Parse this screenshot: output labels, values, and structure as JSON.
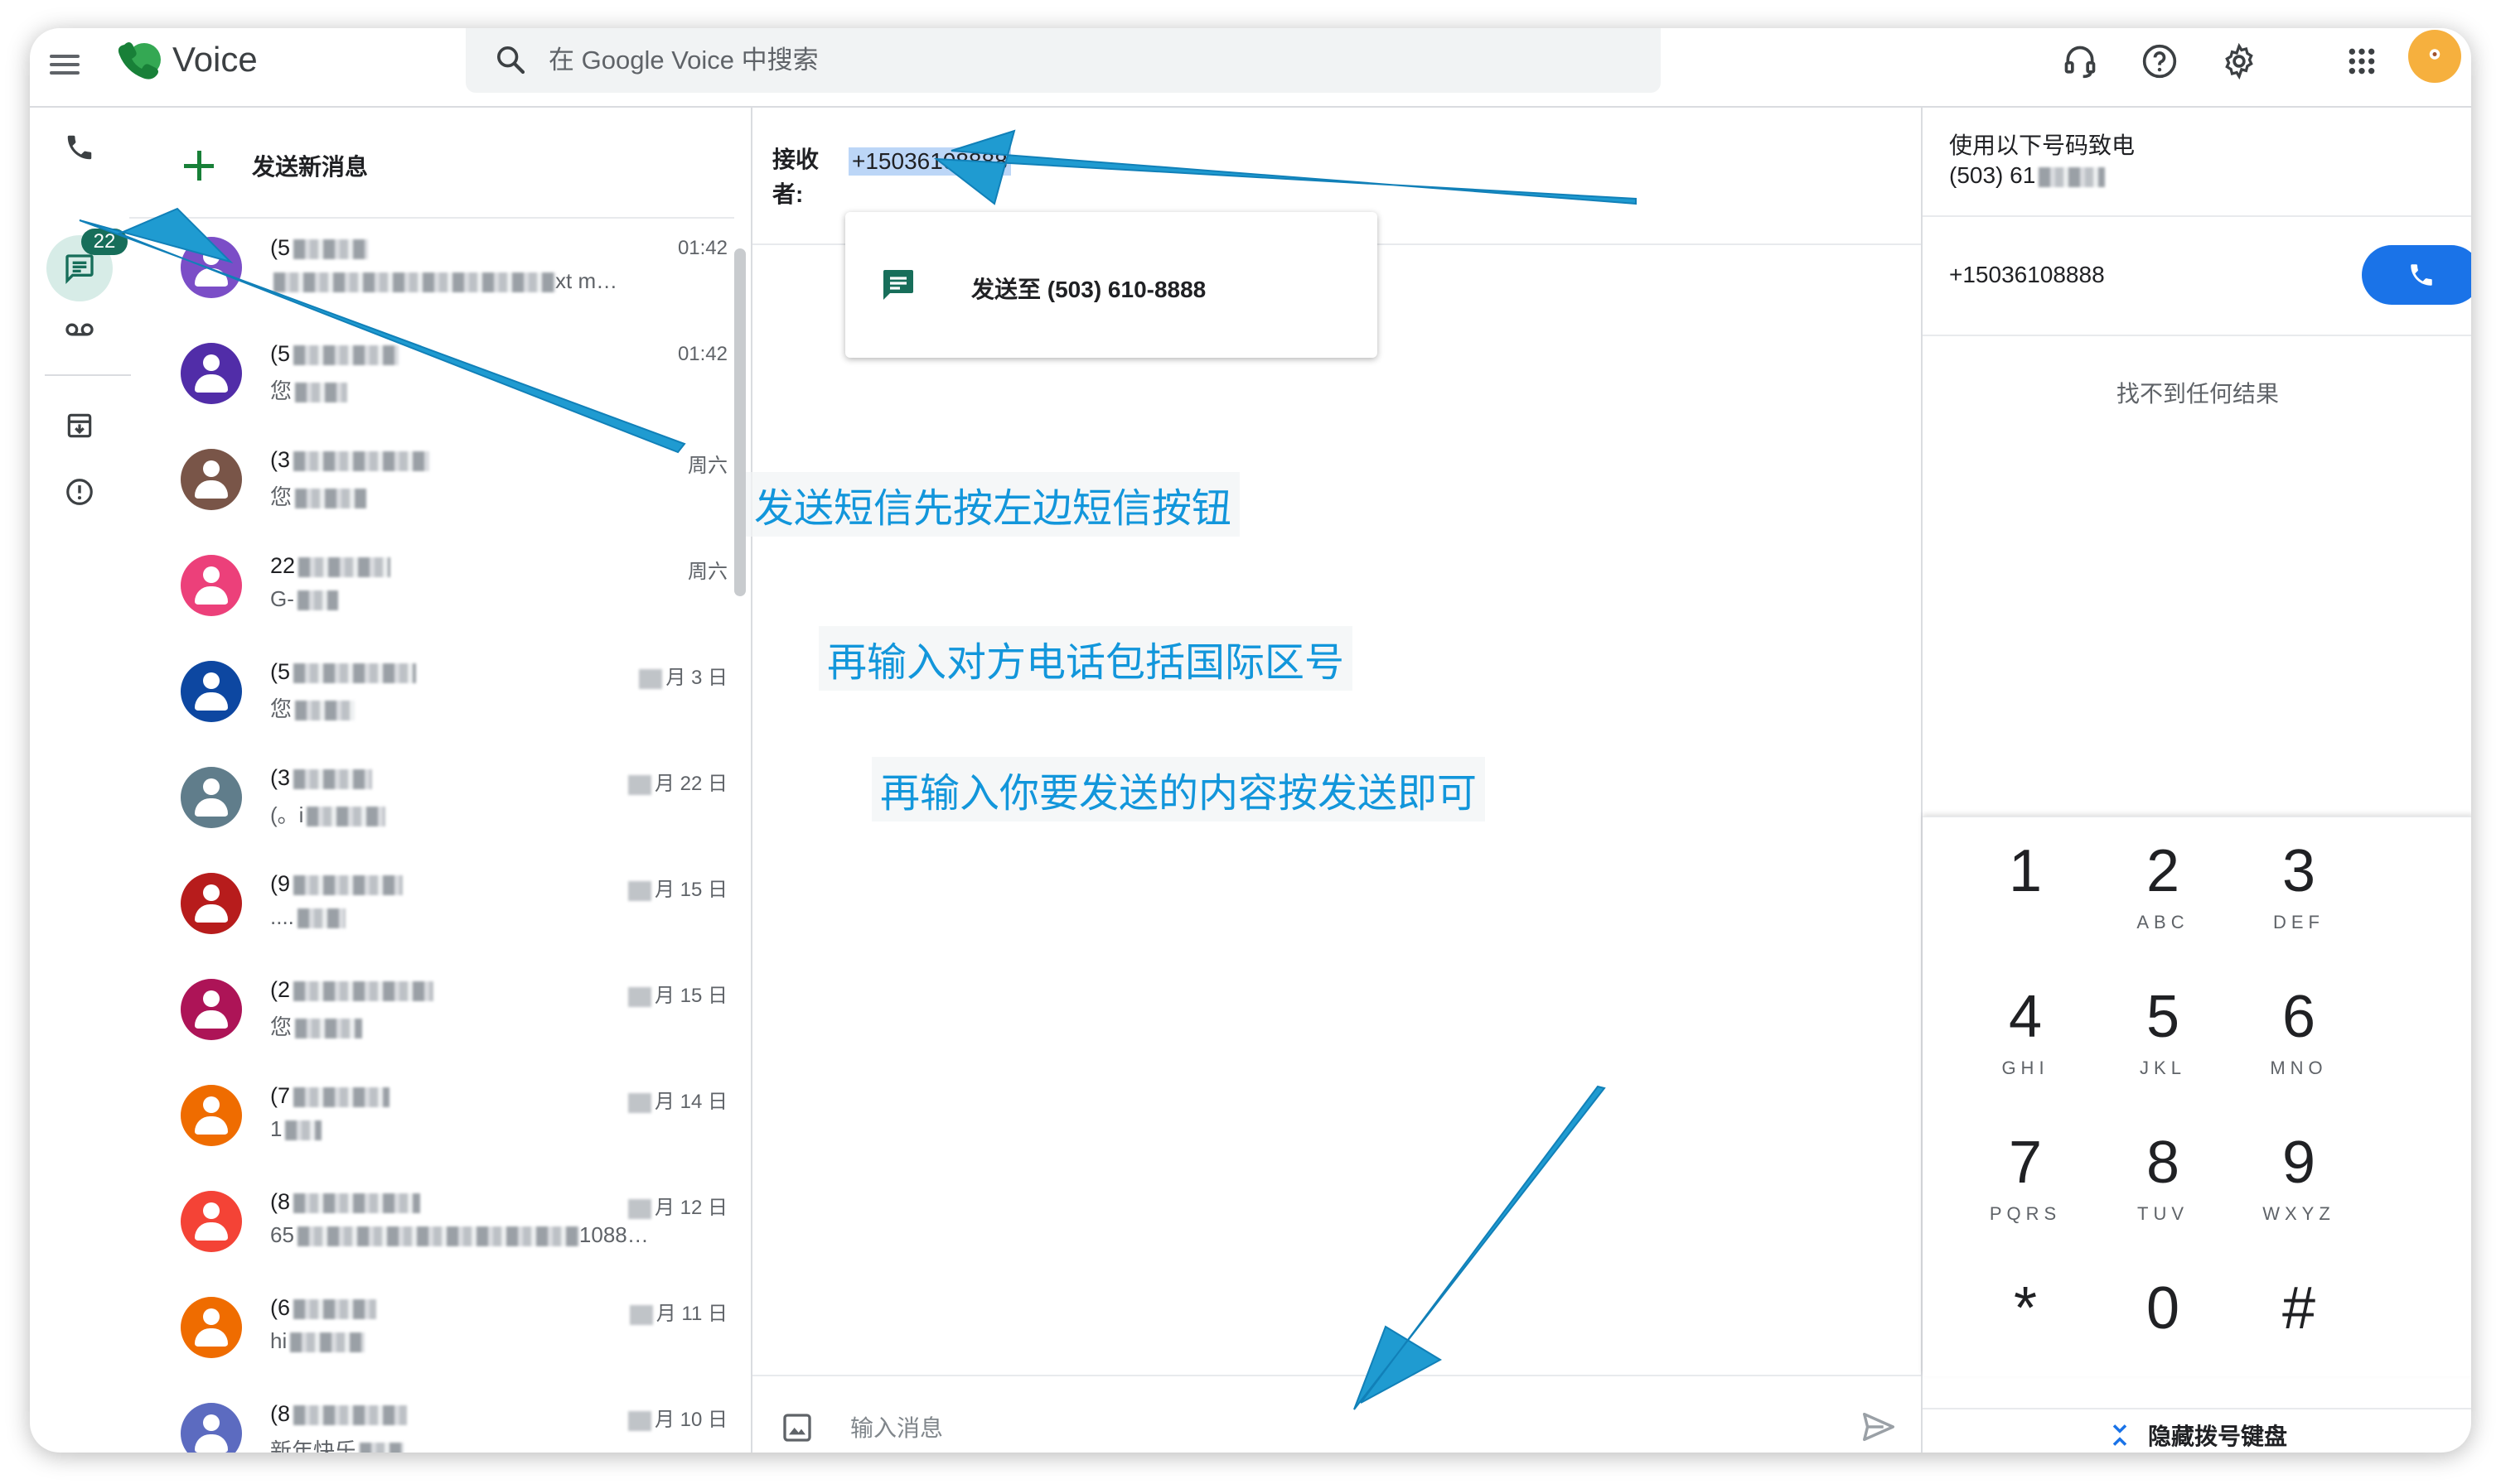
{
  "app": {
    "title": "Voice"
  },
  "search": {
    "placeholder": "在 Google Voice 中搜索"
  },
  "header_icons": [
    "support-icon",
    "help-icon",
    "settings-icon",
    "apps-icon",
    "account-avatar"
  ],
  "rail": {
    "messages_badge": "22"
  },
  "list": {
    "new_message_label": "发送新消息",
    "rows": [
      {
        "name": "(5",
        "snippet": "",
        "snippet_end": "xt m…",
        "time": "01:42",
        "color": "#7b4ec7"
      },
      {
        "name": "(5",
        "snippet": "您",
        "snippet_end": "",
        "time": "01:42",
        "color": "#512da8"
      },
      {
        "name": "(3",
        "snippet": "您",
        "snippet_end": "",
        "time": "周六",
        "color": "#795548"
      },
      {
        "name": "22",
        "snippet": "G-",
        "snippet_end": "",
        "time": "周六",
        "color": "#ec407a"
      },
      {
        "name": "(5",
        "snippet": "您",
        "snippet_end": "",
        "time": "月 3 日",
        "color": "#0d47a1"
      },
      {
        "name": "(3",
        "snippet": "(。i",
        "snippet_end": "",
        "time": "月 22 日",
        "color": "#607d8b"
      },
      {
        "name": "(9",
        "snippet": "....",
        "snippet_end": "",
        "time": "月 15 日",
        "color": "#b71c1c"
      },
      {
        "name": "(2",
        "snippet": "您",
        "snippet_end": "",
        "time": "月 15 日",
        "color": "#ad1457"
      },
      {
        "name": "(7",
        "snippet": "1",
        "snippet_end": "",
        "time": "月 14 日",
        "color": "#ef6c00"
      },
      {
        "name": "(8",
        "snippet": "65",
        "snippet_end": "1088…",
        "time": "月 12 日",
        "color": "#f44336"
      },
      {
        "name": "(6",
        "snippet": "hi",
        "snippet_end": "",
        "time": "月 11 日",
        "color": "#ef6c00"
      },
      {
        "name": "(8",
        "snippet": "新年快乐",
        "snippet_end": "",
        "time": "月 10 日",
        "color": "#5c6bc0"
      }
    ]
  },
  "conversation": {
    "to_label": "接收者:",
    "to_value": "+15036108888",
    "suggestion": "发送至 (503) 610-8888",
    "compose_placeholder": "输入消息"
  },
  "annotations": {
    "a1": "发送短信先按左边短信按钮",
    "a2": "再输入对方电话包括国际区号",
    "a3": "再输入你要发送的内容按发送即可"
  },
  "dialer": {
    "call_from_label": "使用以下号码致电",
    "call_from_number": "(503) 61",
    "number": "+15036108888",
    "no_results": "找不到任何结果",
    "keys": [
      {
        "digit": "1",
        "letters": ""
      },
      {
        "digit": "2",
        "letters": "ABC"
      },
      {
        "digit": "3",
        "letters": "DEF"
      },
      {
        "digit": "4",
        "letters": "GHI"
      },
      {
        "digit": "5",
        "letters": "JKL"
      },
      {
        "digit": "6",
        "letters": "MNO"
      },
      {
        "digit": "7",
        "letters": "PQRS"
      },
      {
        "digit": "8",
        "letters": "TUV"
      },
      {
        "digit": "9",
        "letters": "WXYZ"
      },
      {
        "digit": "*",
        "letters": ""
      },
      {
        "digit": "0",
        "letters": ""
      },
      {
        "digit": "#",
        "letters": ""
      }
    ],
    "hide_label": "隐藏拨号键盘"
  },
  "colors": {
    "accent_green": "#188038",
    "call_blue": "#1a73e8",
    "annotation_blue": "#1296db"
  }
}
